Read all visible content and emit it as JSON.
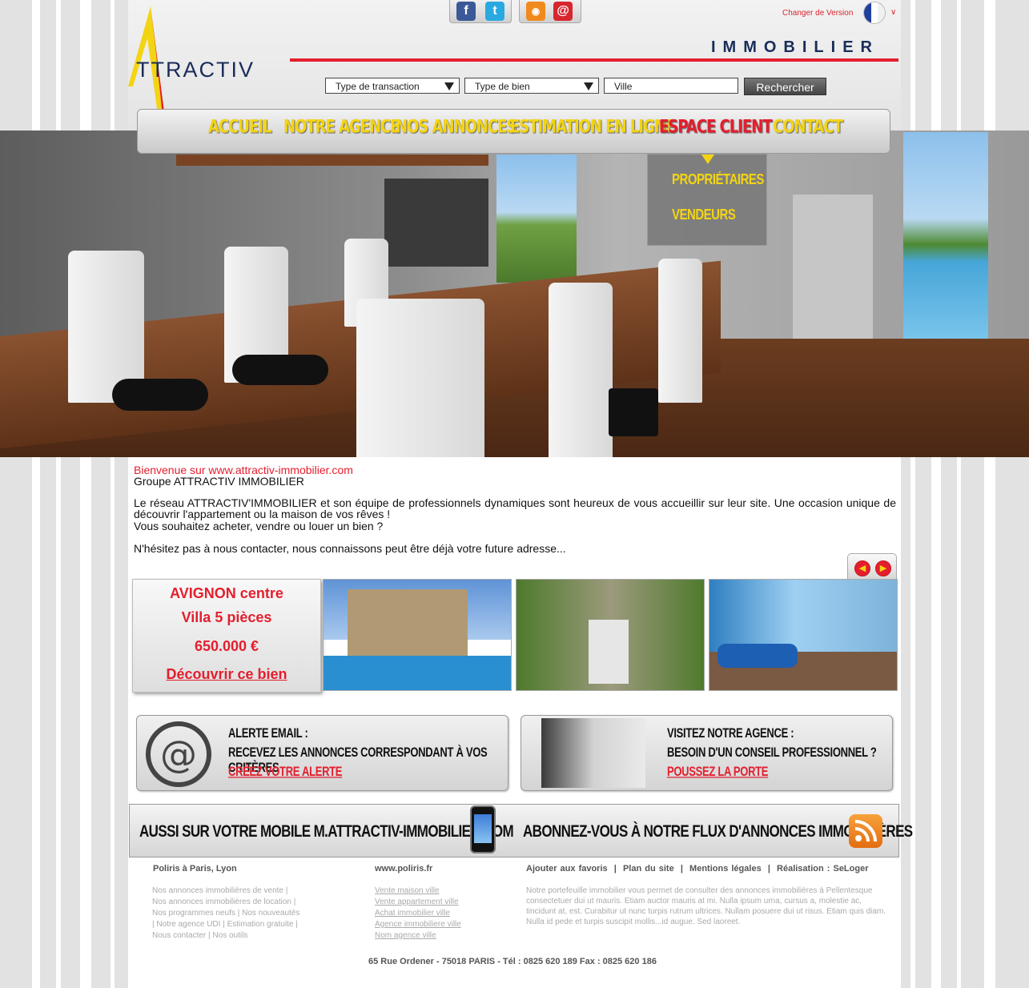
{
  "header": {
    "changer_version": "Changer de Version",
    "logo_text": "TTRACTIV",
    "logo_letter": "A",
    "immobilier": "IMMOBILIER",
    "social": {
      "facebook": "f",
      "twitter": "t",
      "rss": "◉",
      "email": "@"
    }
  },
  "search": {
    "transaction": "Type de transaction",
    "bien": "Type de bien",
    "ville_placeholder": "Ville",
    "button": "Rechercher"
  },
  "nav": {
    "items": [
      "ACCUEIL",
      "NOTRE AGENCE",
      "NOS ANNONCES",
      "ESTIMATION EN LIGNE",
      "ESPACE CLIENT",
      "CONTACT"
    ],
    "dropdown": [
      "PROPRIÉTAIRES",
      "VENDEURS"
    ]
  },
  "intro": {
    "welcome": "Bienvenue sur www.attractiv-immobilier.com",
    "group": "Groupe ATTRACTIV IMMOBILIER",
    "para1": "Le réseau ATTRACTIV'IMMOBILIER et son équipe de professionnels dynamiques sont heureux de vous accueillir sur leur site. Une occasion unique de découvrir l'appartement ou la maison de vos rêves !",
    "para2": "Vous souhaitez acheter, vendre ou louer un bien ?",
    "para3": "N'hésitez pas à nous contacter, nous connaissons peut être déjà votre future adresse..."
  },
  "featured": {
    "city": "AVIGNON centre",
    "type": "Villa 5 pièces",
    "price": "650.000 €",
    "link": "Découvrir ce bien"
  },
  "promo": {
    "alert_title": "ALERTE EMAIL :",
    "alert_text": "RECEVEZ LES ANNONCES CORRESPONDANT À VOS CRITÈRES",
    "alert_link": "CRÉEZ VOTRE ALERTE",
    "visit_title": "VISITEZ NOTRE AGENCE :",
    "visit_text": "BESOIN D'UN CONSEIL PROFESSIONNEL ?",
    "visit_link": "POUSSEZ LA PORTE"
  },
  "mobile_bar": {
    "mobile_text": "AUSSI SUR VOTRE  MOBILE M.ATTRACTIV-IMMOBILIER.COM",
    "rss_text": "ABONNEZ-VOUS À NOTRE FLUX D'ANNONCES IMMOBILIÈRES"
  },
  "footer": {
    "col1_title": "Poliris à Paris, Lyon",
    "col1_lines": [
      "Nos annonces immobilières de vente |",
      "Nos annonces immobilières de location |",
      "Nos programmes neufs | Nos nouveautés",
      "| Notre agence UDI | Estimation gratuite |",
      "Nous contacter | Nos outils"
    ],
    "col2_title": "www.poliris.fr",
    "col2_links": [
      "Vente maison ville",
      "Vente appartement ville",
      "Achat immobilier ville",
      "Agence immobiliere ville",
      "Nom agence ville"
    ],
    "col3_links": [
      "Ajouter aux favoris",
      "Plan du site",
      "Mentions légales",
      "Réalisation : SeLoger"
    ],
    "col3_sep": "|",
    "col3_text": "Notre portefeuille immobilier vous permet de consulter des annonces immobilières à Pellentesque consectetuer dui ut mauris. Etiam auctor mauris at mi. Nulla ipsum urna, cursus a, molestie ac, tincidunt at, est. Curabitur ut nunc turpis rutrum ultrices. Nullam posuere dui ut risus. Etiam quis diam. Nulla id pede et turpis suscipit mollis...id augue. Sed laoreet.",
    "address": "65 Rue Ordener - 75018 PARIS  -  Tél : 0825 620 189  Fax : 0825 620 186"
  },
  "colors": {
    "brand_red": "#e41e2d",
    "brand_yellow": "#f3d414",
    "navy": "#1a2d5a"
  }
}
